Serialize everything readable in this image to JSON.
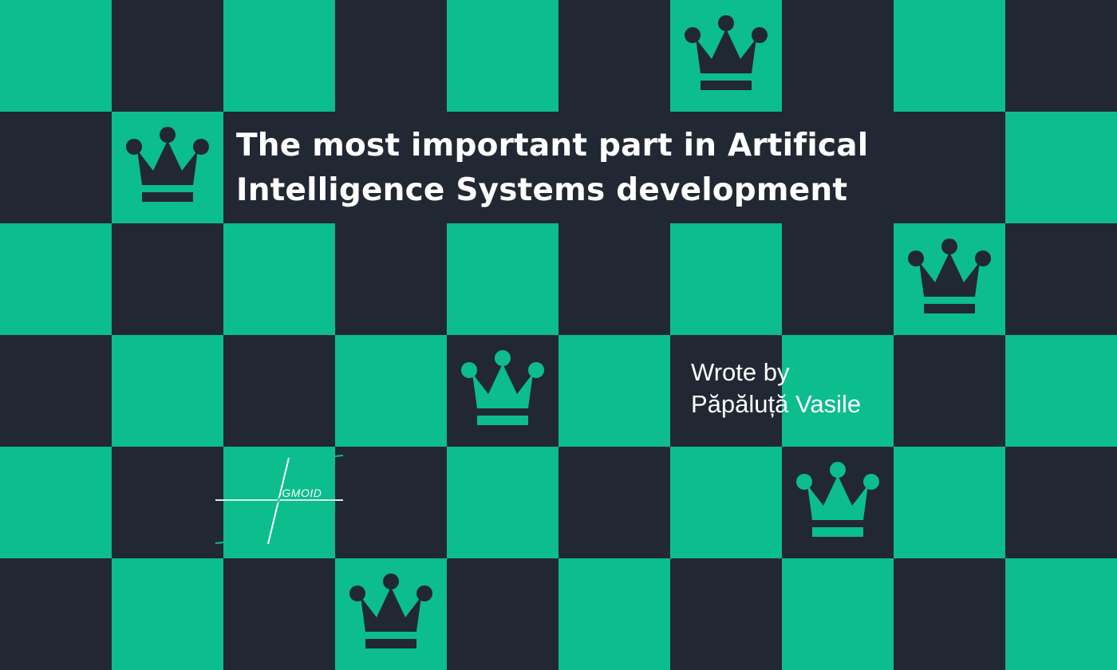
{
  "title": {
    "line1": "The most important part in Artifical",
    "line2": "Intelligence Systems development"
  },
  "author": {
    "line1": "Wrote by",
    "line2": "Păpăluță Vasile"
  },
  "sigmoid": {
    "label": "IGMOID"
  },
  "board": {
    "rows": 6,
    "cols": 10,
    "colors": {
      "light": "#0cbd8d",
      "dark": "#222833",
      "text": "#ffffff"
    }
  },
  "crowns": {
    "icon": "crown-icon",
    "squares": [
      {
        "row": 0,
        "col": 6,
        "color": "dark"
      },
      {
        "row": 1,
        "col": 1,
        "color": "dark"
      },
      {
        "row": 2,
        "col": 8,
        "color": "dark"
      },
      {
        "row": 3,
        "col": 4,
        "color": "light"
      },
      {
        "row": 4,
        "col": 7,
        "color": "light"
      },
      {
        "row": 5,
        "col": 3,
        "color": "dark"
      }
    ]
  }
}
